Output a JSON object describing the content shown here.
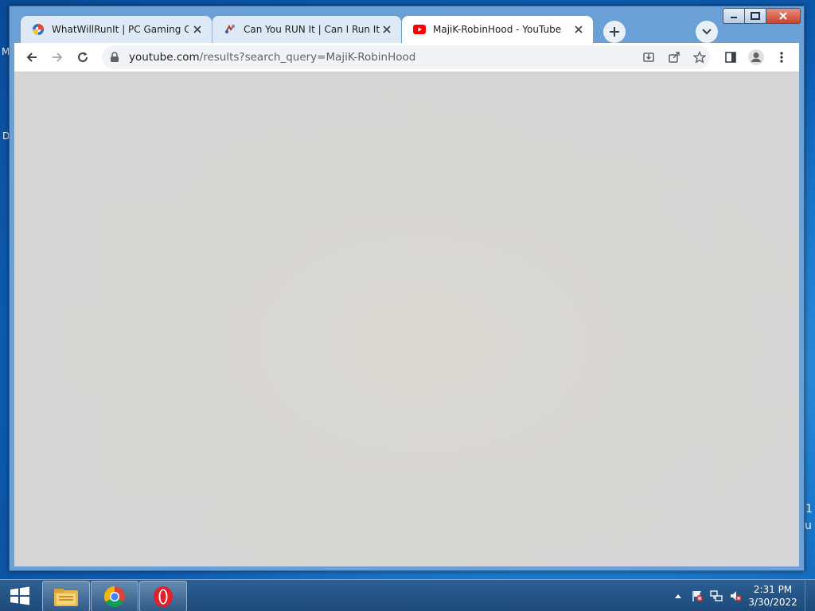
{
  "desktop": {
    "left_glyph_top": "M",
    "left_glyph_mid": "D",
    "right_glyph_1": "1",
    "right_glyph_2": "u"
  },
  "browser": {
    "tabs": [
      {
        "title": "WhatWillRunIt | PC Gaming Com",
        "favicon": "whatwillrunit-icon",
        "active": false
      },
      {
        "title": "Can You RUN It | Can I Run It | Ca",
        "favicon": "canyourunit-icon",
        "active": false
      },
      {
        "title": "MajiK-RobinHood - YouTube",
        "favicon": "youtube-icon",
        "active": true
      }
    ],
    "url_host": "youtube.com",
    "url_rest": "/results?search_query=MajiK-RobinHood",
    "colors": {
      "tab_inactive": "#dee9f6",
      "tab_active": "#ffffff",
      "youtube_red": "#ff0000",
      "viewport_bg": "#d6d6d6"
    }
  },
  "taskbar": {
    "apps": [
      "file-explorer-icon",
      "chrome-icon",
      "opera-icon"
    ],
    "time": "2:31 PM",
    "date": "3/30/2022"
  }
}
